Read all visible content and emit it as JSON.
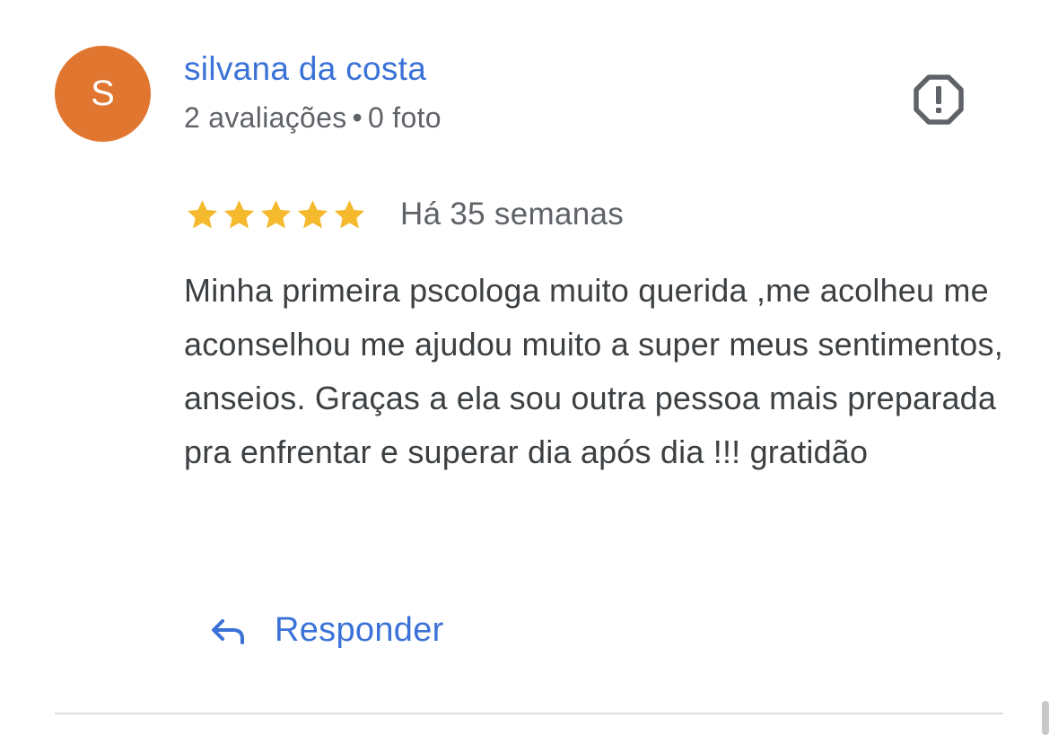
{
  "author": {
    "initial": "S",
    "name": "silvana da costa",
    "reviews_count": "2 avaliações",
    "separator": "•",
    "photos_count": "0 foto"
  },
  "rating": {
    "stars": 5,
    "max_stars": 5,
    "time_ago": "Há 35 semanas"
  },
  "review": {
    "text": "Minha primeira pscologa muito querida ,me acolheu me aconselhou me ajudou muito a super meus sentimentos, anseios. Graças a ela sou outra pessoa mais preparada pra enfrentar e superar dia após dia !!! gratidão"
  },
  "actions": {
    "reply_label": "Responder",
    "reply_icon": "reply-arrow-icon",
    "flag_icon": "report-flag-icon"
  },
  "colors": {
    "avatar_bg": "#e0762f",
    "link_blue": "#3b72d8",
    "star_gold": "#f4b92d",
    "meta_gray": "#5f6368",
    "text_dark": "#3c4043"
  }
}
